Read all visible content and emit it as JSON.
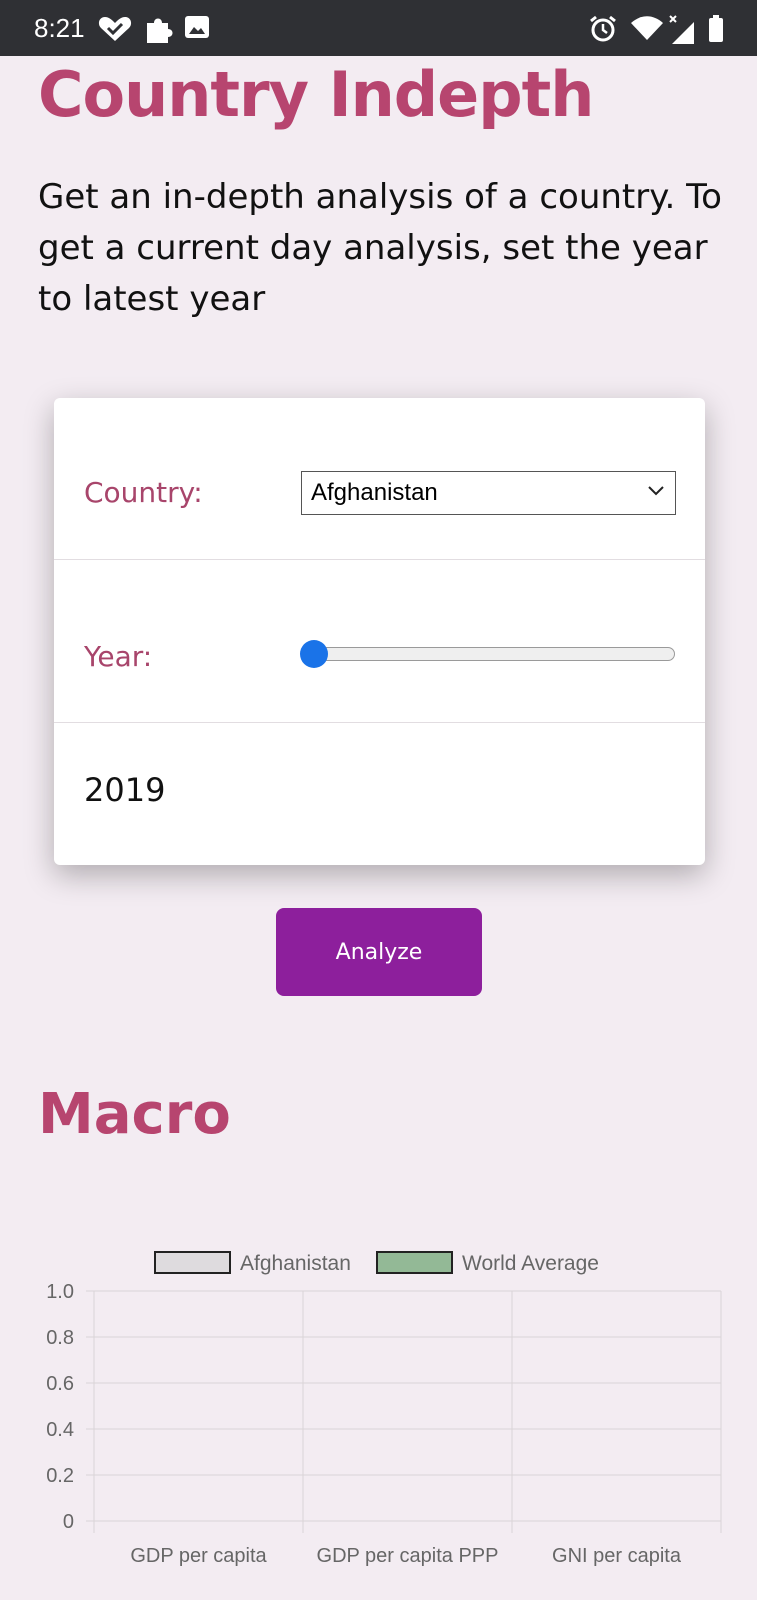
{
  "status_bar": {
    "time": "8:21",
    "icons": [
      "heart-check-icon",
      "puzzle-icon",
      "image-icon",
      "alarm-icon",
      "wifi-icon",
      "signal-icon",
      "battery-icon"
    ]
  },
  "page": {
    "title": "Country Indepth",
    "description": "Get an in-depth analysis of a country. To get a current day analysis, set the year to latest year"
  },
  "form": {
    "country_label": "Country:",
    "country_value": "Afghanistan",
    "year_label": "Year:",
    "year_value": "2019",
    "slider_fraction": 0.0
  },
  "analyze_button": "Analyze",
  "section": {
    "title": "Macro"
  },
  "colors": {
    "accent": "#b7456f",
    "button": "#8d1f9c",
    "slider": "#1a73e8",
    "background": "#f3ecf2",
    "series_afghanistan": "#dedbde",
    "series_world": "#93b996"
  },
  "chart_data": {
    "type": "bar",
    "categories": [
      "GDP per capita",
      "GDP per capita PPP",
      "GNI per capita"
    ],
    "series": [
      {
        "name": "Afghanistan",
        "values": [
          0,
          0,
          0
        ]
      },
      {
        "name": "World Average",
        "values": [
          0,
          0,
          0
        ]
      }
    ],
    "ylim": [
      0,
      1.0
    ],
    "yticks": [
      "0",
      "0.2",
      "0.4",
      "0.6",
      "0.8",
      "1.0"
    ],
    "grid": true,
    "legend": "top"
  }
}
